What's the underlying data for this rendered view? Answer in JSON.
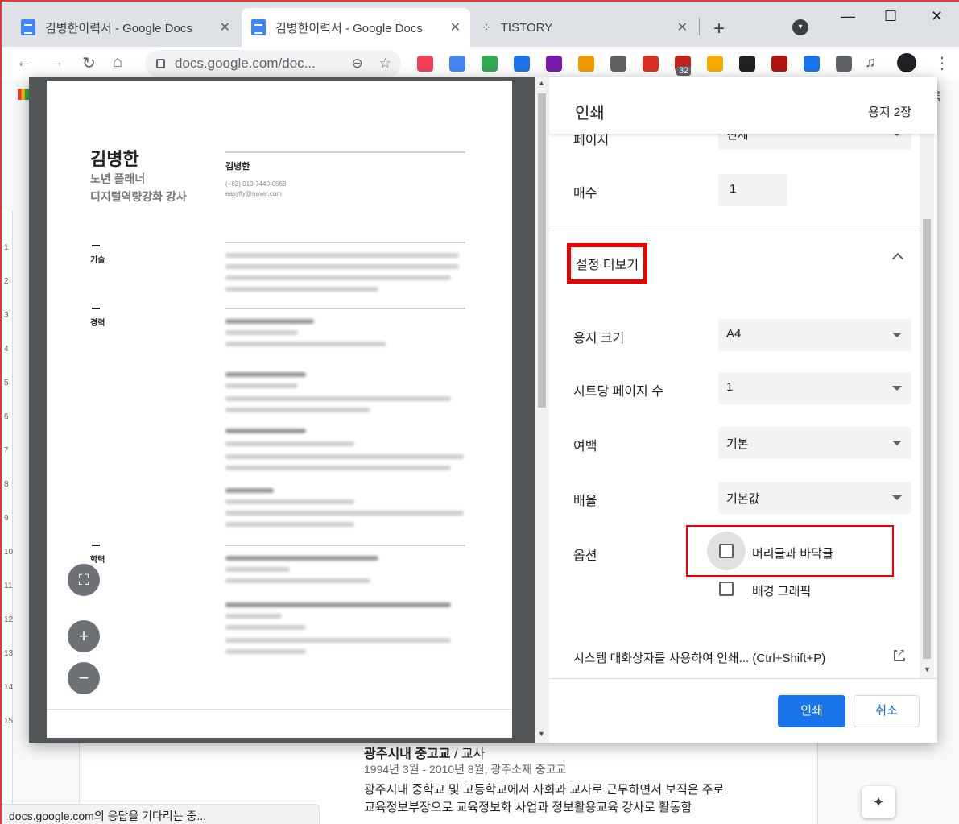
{
  "browser": {
    "tabs": [
      {
        "title": "김병한이력서 - Google Docs",
        "close": "✕"
      },
      {
        "title": "김병한이력서 - Google Docs",
        "close": "✕"
      },
      {
        "title": "TISTORY",
        "close": "✕"
      }
    ],
    "new_tab": "+",
    "window": {
      "minimize": "—",
      "maximize": "☐",
      "close": "✕"
    },
    "nav": {
      "back": "←",
      "forward": "→",
      "reload": "↻",
      "home": "⌂"
    },
    "address": {
      "url": "docs.google.com/doc...",
      "zoom_glyph": "⊖",
      "star_glyph": "☆"
    },
    "extensions": [
      {
        "name": "pocket-icon",
        "color": "#ef4056"
      },
      {
        "name": "translate-icon",
        "color": "#4285f4"
      },
      {
        "name": "speed-icon",
        "color": "#34a853"
      },
      {
        "name": "reader-icon",
        "color": "#1a73e8"
      },
      {
        "name": "onenote-icon",
        "color": "#7719aa"
      },
      {
        "name": "layout-icon",
        "color": "#f29900"
      },
      {
        "name": "stamp-icon",
        "color": "#5f6368"
      },
      {
        "name": "screen-icon",
        "color": "#d93025"
      },
      {
        "name": "shield-icon",
        "color": "#c5221f"
      },
      {
        "name": "penguin-icon",
        "color": "#f9ab00"
      },
      {
        "name": "clapper-icon",
        "color": "#202124"
      },
      {
        "name": "h-icon",
        "color": "#b31412"
      },
      {
        "name": "circle-icon",
        "color": "#1a73e8"
      },
      {
        "name": "puzzle-icon",
        "color": "#5f6368"
      }
    ],
    "extension_badge": "32",
    "menu": "⋮"
  },
  "status_bar": "docs.google.com의 응답을 기다리는 중...",
  "docs_background": {
    "bookmark_label": "록",
    "heading_bold": "광주시내 중고교",
    "heading_rest": " / 교사",
    "subline": "1994년 3월 - 2010년 8월, 광주소재 중고교",
    "body_line1": "광주시내 중학교 및 고등학교에서 사회과 교사로 근무하면서 보직은 주로",
    "body_line2": "교육정보부장으로 교육정보화 사업과 정보활용교육 강사로 활동함",
    "ruler_numbers": [
      "1",
      "2",
      "3",
      "4",
      "5",
      "6",
      "7",
      "8",
      "9",
      "10",
      "11",
      "12",
      "13",
      "14",
      "15"
    ]
  },
  "preview": {
    "name": "김병한",
    "role1": "노년 플래너",
    "role2": "디지털역량강화 강사",
    "name_small": "김병한",
    "phone": "(+82) 010-7440-0568",
    "email": "easyfly@naver.com",
    "sections": [
      "기술",
      "경력",
      "학력"
    ],
    "zoom_fit": "⛶",
    "zoom_in": "+",
    "zoom_out": "−"
  },
  "print": {
    "title": "인쇄",
    "sheet_count": "용지 2장",
    "pages_label": "페이지",
    "pages_value": "전체",
    "copies_label": "매수",
    "copies_value": "1",
    "more_settings": "설정 더보기",
    "paper_size_label": "용지 크기",
    "paper_size_value": "A4",
    "pages_per_sheet_label": "시트당 페이지 수",
    "pages_per_sheet_value": "1",
    "margins_label": "여백",
    "margins_value": "기본",
    "scale_label": "배율",
    "scale_value": "기본값",
    "options_label": "옵션",
    "opt_headers_footers": "머리글과 바닥글",
    "opt_headers_footers_checked": false,
    "opt_background_graphics": "배경 그래픽",
    "opt_background_graphics_checked": false,
    "system_dialog": "시스템 대화상자를 사용하여 인쇄... (Ctrl+Shift+P)",
    "print_button": "인쇄",
    "cancel_button": "취소"
  },
  "colors": {
    "accent": "#1a73e8",
    "highlight": "#e00000"
  }
}
